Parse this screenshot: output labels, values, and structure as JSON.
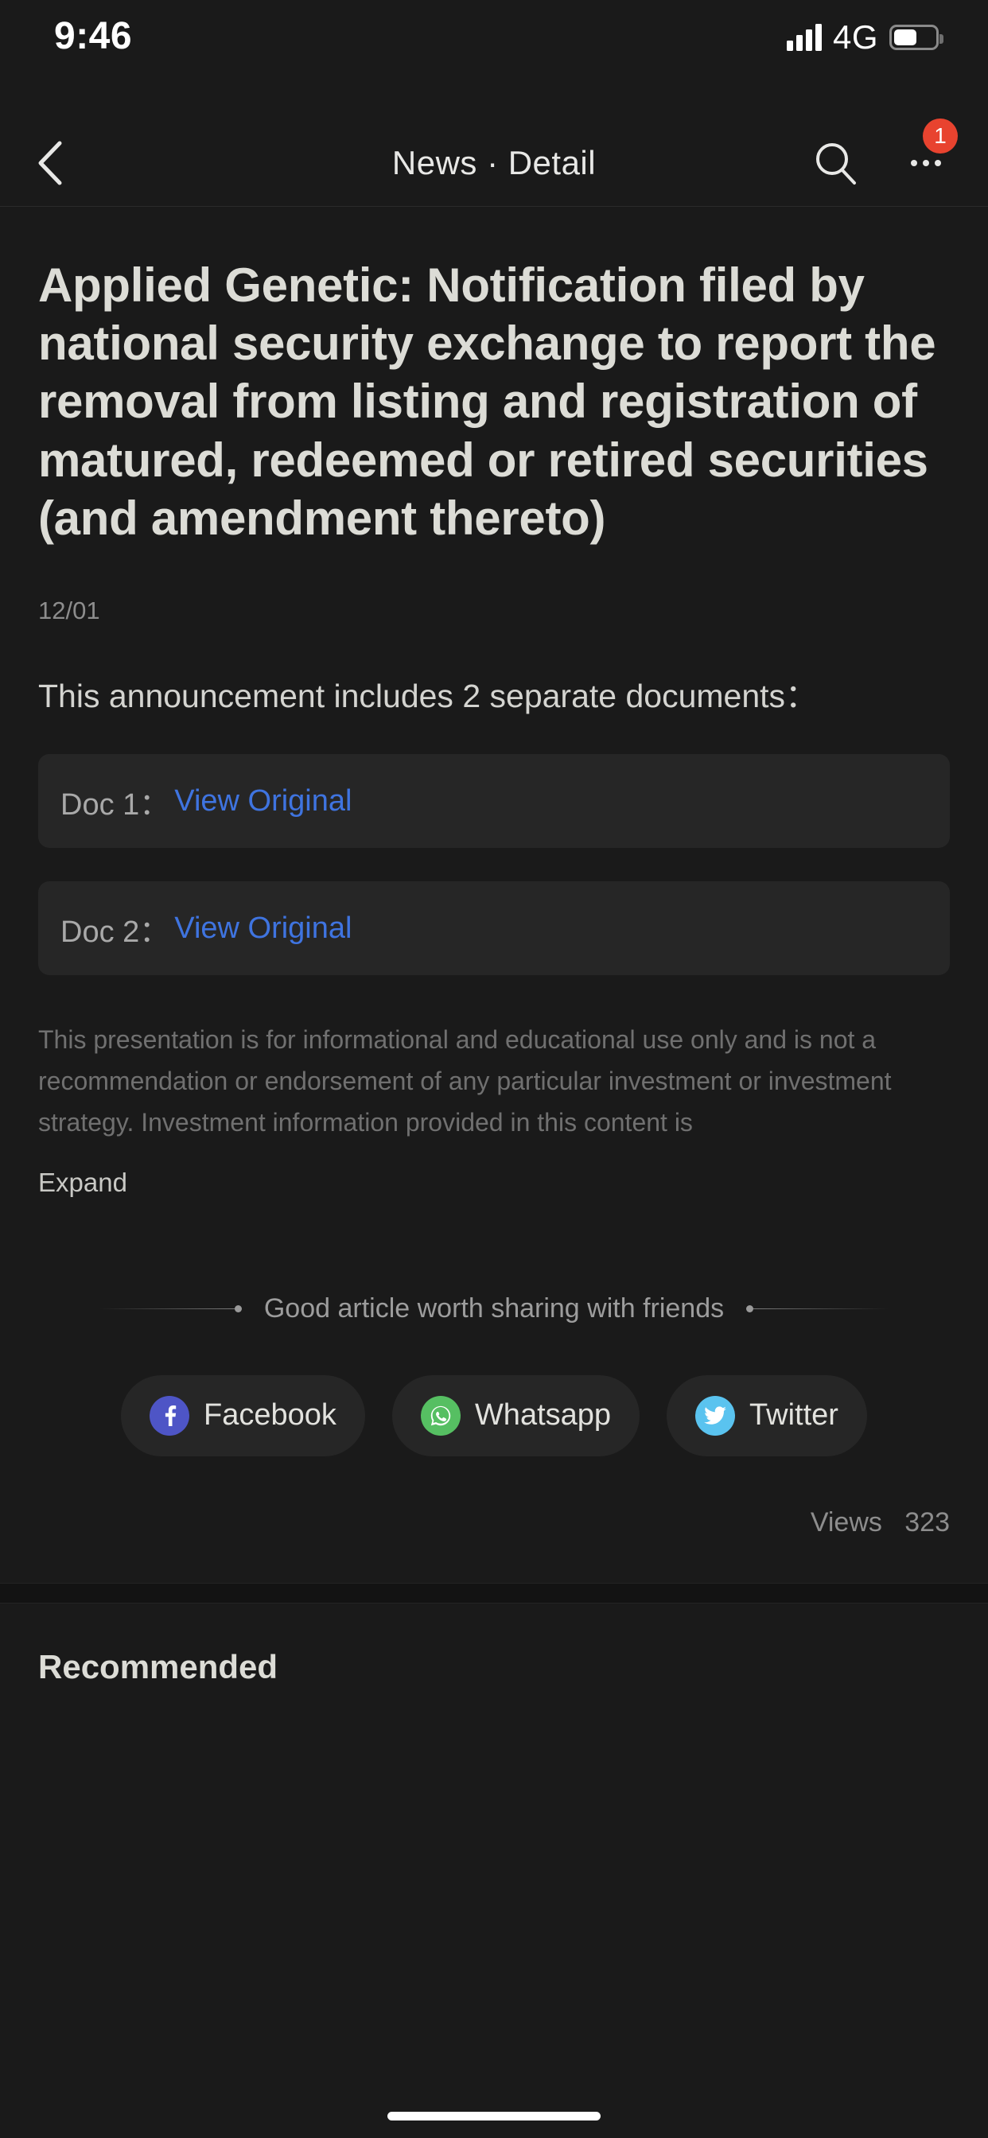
{
  "status_bar": {
    "time": "9:46",
    "network": "4G",
    "signal_icon": "signal-bars-icon",
    "battery_icon": "battery-icon"
  },
  "nav": {
    "back_icon": "chevron-left-icon",
    "title": "News · Detail",
    "search_icon": "search-icon",
    "more_icon": "more-dots-icon",
    "badge_count": "1"
  },
  "article": {
    "headline": "Applied Genetic: Notification filed by national security exchange to report the removal from listing and registration of matured, redeemed or retired securities (and amendment thereto)",
    "date": "12/01",
    "lead": "This announcement includes  2 separate documents：",
    "documents": [
      {
        "label": "Doc 1：",
        "link_text": "View Original"
      },
      {
        "label": "Doc 2：",
        "link_text": "View Original"
      }
    ],
    "disclaimer": "This presentation is for informational and educational use only and is not a recommendation or endorsement of any particular investment or investment strategy. Investment information provided in this content is",
    "expand_label": "Expand",
    "views_label": "Views",
    "views_count": "323"
  },
  "share": {
    "prompt": "Good article worth sharing with friends",
    "buttons": [
      {
        "label": "Facebook",
        "icon": "facebook-icon",
        "color": "#4e55c6"
      },
      {
        "label": "Whatsapp",
        "icon": "whatsapp-icon",
        "color": "#56bf62"
      },
      {
        "label": "Twitter",
        "icon": "twitter-icon",
        "color": "#5ac3ef"
      }
    ]
  },
  "footer": {
    "recommended_title": "Recommended"
  },
  "colors": {
    "background": "#1a1a1a",
    "card": "#262626",
    "link": "#3f74e0",
    "badge": "#e8432f",
    "text_primary": "#dcdcd6",
    "text_muted": "#8d8d8d"
  }
}
